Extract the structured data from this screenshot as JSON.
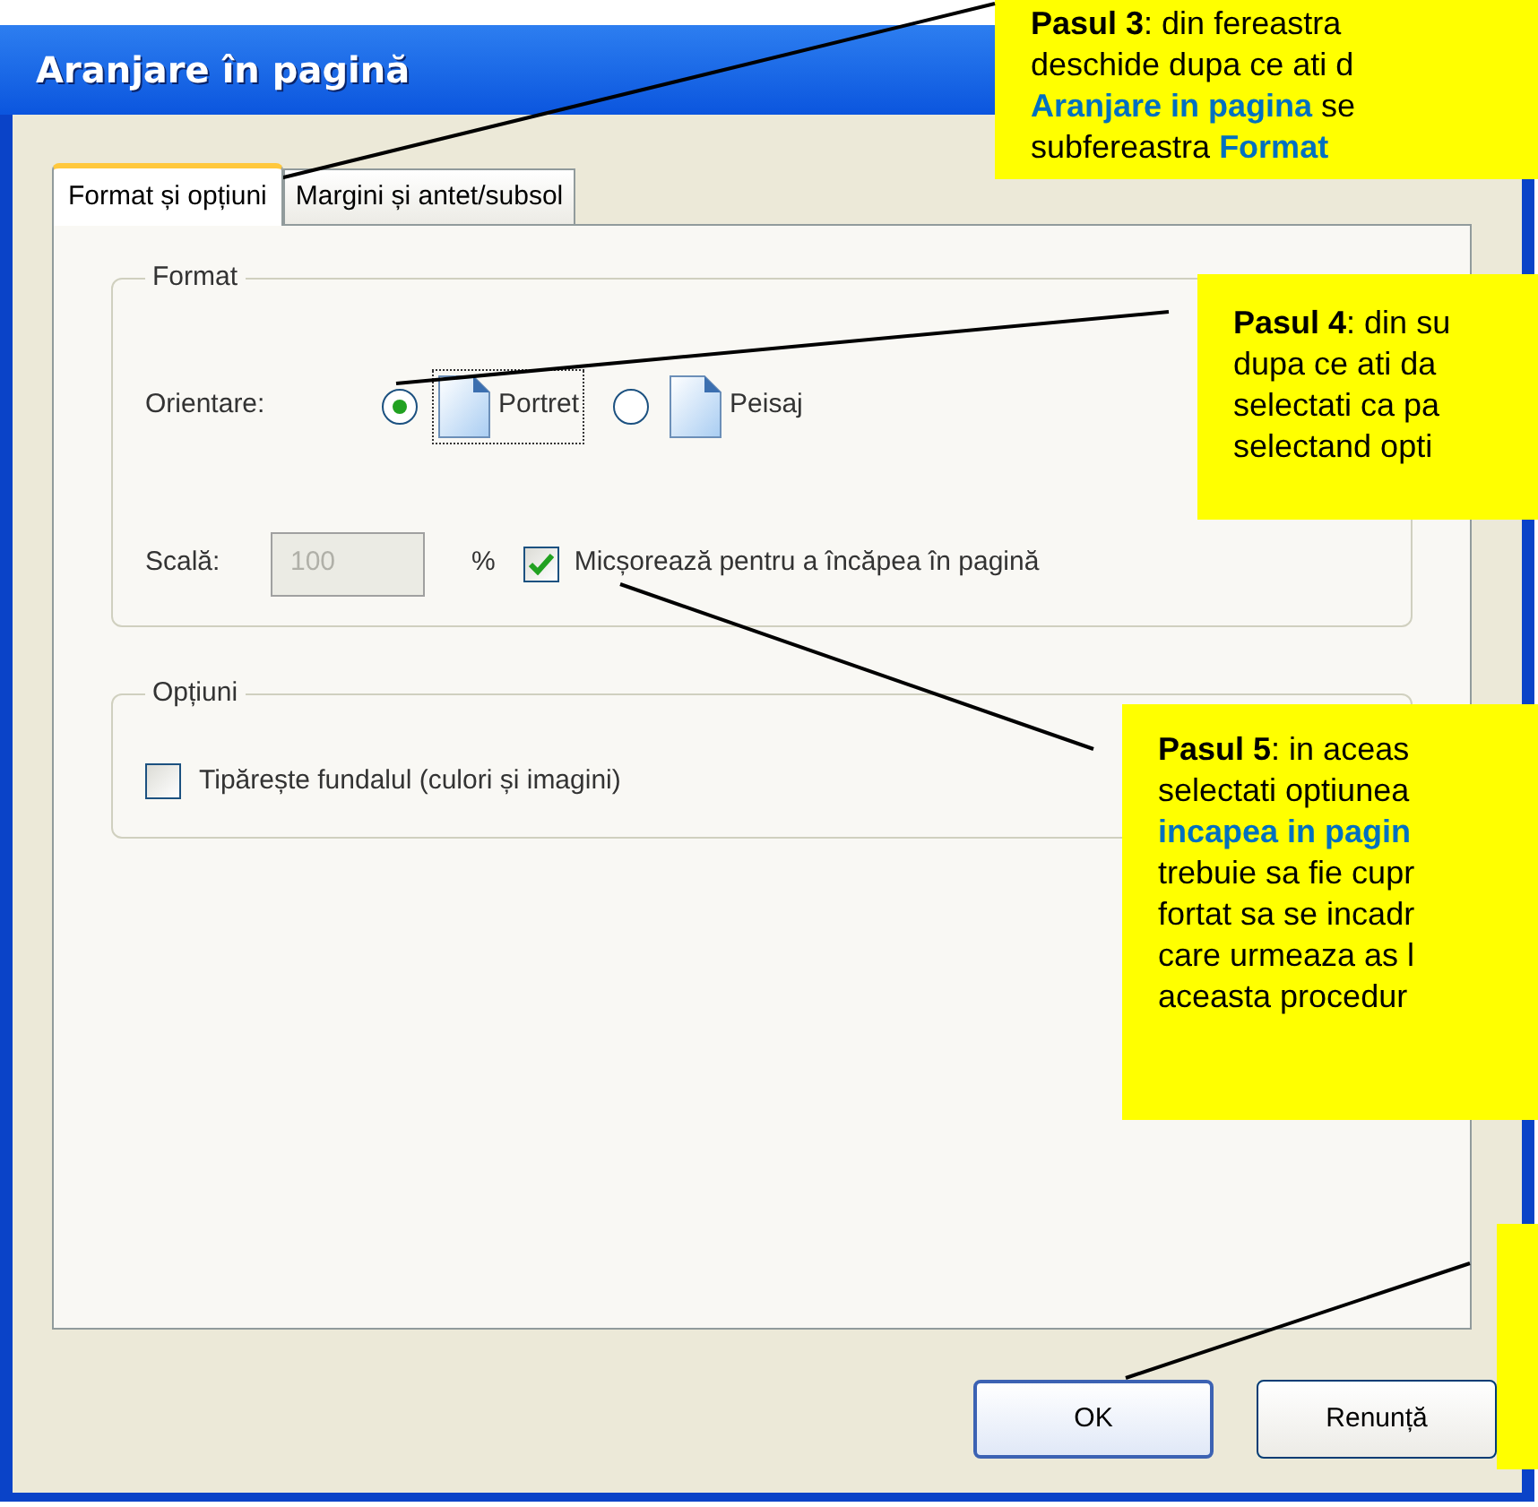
{
  "window": {
    "title": "Aranjare în pagină"
  },
  "tabs": [
    {
      "label": "Format și opțiuni",
      "selected": true
    },
    {
      "label": "Margini și antet/subsol",
      "selected": false
    }
  ],
  "format_group": {
    "title": "Format",
    "orientation": {
      "label": "Orientare:",
      "options": [
        {
          "label": "Portret",
          "selected": true
        },
        {
          "label": "Peisaj",
          "selected": false
        }
      ]
    },
    "scale": {
      "label": "Scală:",
      "value": "100",
      "disabled": true,
      "unit": "%"
    },
    "shrink": {
      "label": "Micșorează pentru a încăpea în pagină",
      "checked": true
    }
  },
  "options_group": {
    "title": "Opțiuni",
    "print_background": {
      "label": "Tipărește fundalul (culori și imagini)",
      "checked": false
    }
  },
  "buttons": [
    {
      "label": "OK"
    },
    {
      "label": "Renunță"
    }
  ],
  "callouts": [
    {
      "lines": [
        [
          {
            "text": "Pasul 3",
            "kind": "bold"
          },
          {
            "text": ": din fereastra",
            "kind": "plain"
          }
        ],
        [
          {
            "text": "deschide dupa ce ati d",
            "kind": "plain"
          }
        ],
        [
          {
            "text": "Aranjare in pagina",
            "kind": "link"
          },
          {
            "text": " se",
            "kind": "plain"
          }
        ],
        [
          {
            "text": "subfereastra ",
            "kind": "plain"
          },
          {
            "text": "Format",
            "kind": "link"
          }
        ]
      ]
    },
    {
      "lines": [
        [
          {
            "text": "Pasul 4",
            "kind": "bold"
          },
          {
            "text": ": din su",
            "kind": "plain"
          }
        ],
        [
          {
            "text": "dupa ce ati da",
            "kind": "plain"
          }
        ],
        [
          {
            "text": "selectati ca pa",
            "kind": "plain"
          }
        ],
        [
          {
            "text": "selectand opti",
            "kind": "plain"
          }
        ]
      ]
    },
    {
      "lines": [
        [
          {
            "text": "Pasul 5",
            "kind": "bold"
          },
          {
            "text": ": in aceas",
            "kind": "plain"
          }
        ],
        [
          {
            "text": "selectati optiunea",
            "kind": "plain"
          }
        ],
        [
          {
            "text": "incapea in pagin",
            "kind": "link"
          }
        ],
        [
          {
            "text": "trebuie sa fie cupr",
            "kind": "plain"
          }
        ],
        [
          {
            "text": "fortat sa se incadr",
            "kind": "plain"
          }
        ],
        [
          {
            "text": "care urmeaza as l",
            "kind": "plain"
          }
        ],
        [
          {
            "text": "aceasta procedur",
            "kind": "plain"
          }
        ]
      ]
    }
  ]
}
